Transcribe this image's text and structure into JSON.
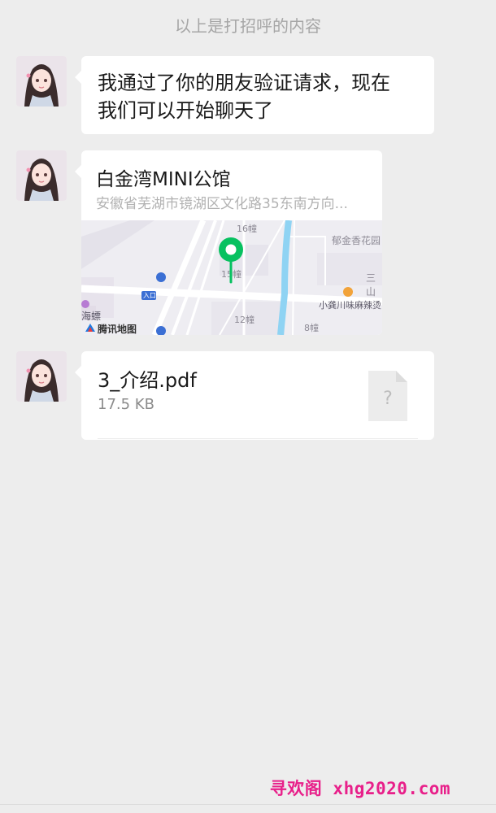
{
  "system_note": "以上是打招呼的内容",
  "messages": {
    "text": {
      "line1": "我通过了你的朋友验证请求，现在",
      "line2": "我们可以开始聊天了"
    },
    "location": {
      "name": "白金湾MINI公馆",
      "address": "安徽省芜湖市镜湖区文化路35东南方向...",
      "map_labels": {
        "b16": "16幢",
        "garden": "郁金香花园",
        "b15": "15幢",
        "sanshan": "三山",
        "entrance": "入口",
        "restaurant": "小龚川味麻辣烫",
        "b12": "12幢",
        "b8": "8幢",
        "haibiao": "海螵",
        "provider": "腾讯地图"
      }
    },
    "file": {
      "name": "3_介绍.pdf",
      "size": "17.5 KB",
      "icon_glyph": "?"
    }
  },
  "watermark": "寻欢阁 xhg2020.com",
  "colors": {
    "pin": "#07c160",
    "water": "#8fd3f3",
    "background": "#ededed"
  }
}
